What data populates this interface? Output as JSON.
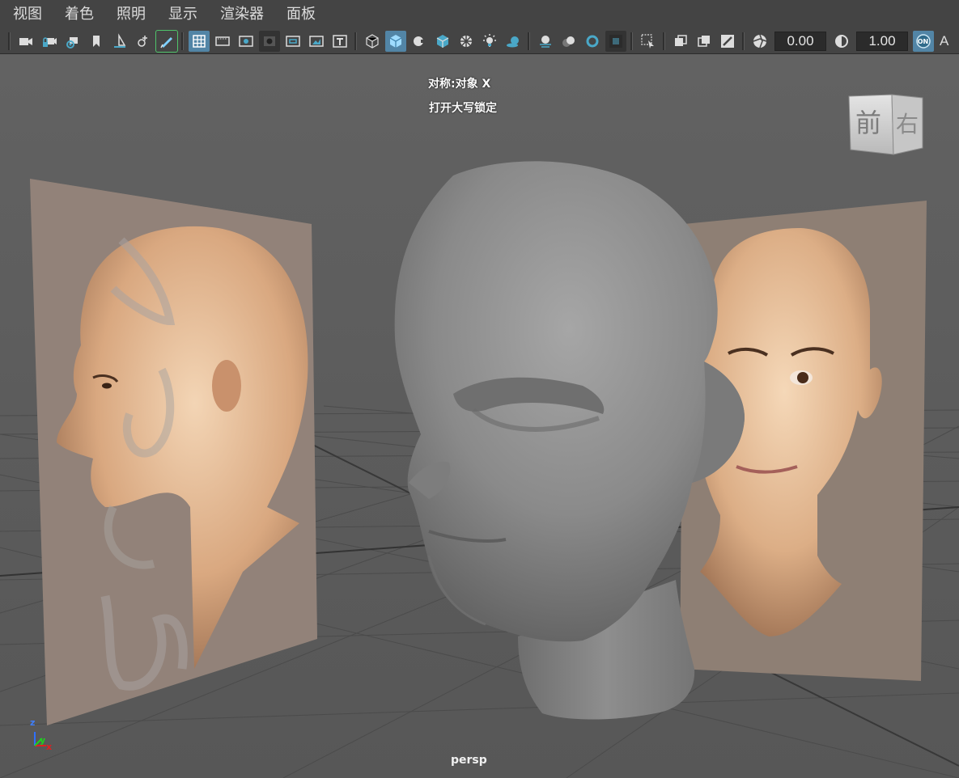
{
  "menu": {
    "items": [
      {
        "label": "视图"
      },
      {
        "label": "着色"
      },
      {
        "label": "照明"
      },
      {
        "label": "显示"
      },
      {
        "label": "渲染器"
      },
      {
        "label": "面板"
      }
    ]
  },
  "toolbar": {
    "exposure_value": "0.00",
    "gamma_value": "1.00",
    "colormgmt_label": "ON",
    "trailing_label": "A",
    "accent_color": "#5285a6"
  },
  "viewport": {
    "hud_symmetry": "对称:对象 X",
    "hud_capslock": "打开大写锁定",
    "camera_name": "persp",
    "viewcube_front": "前",
    "viewcube_right": "右",
    "axis": {
      "z": "z",
      "y": "y",
      "x": "x"
    }
  }
}
